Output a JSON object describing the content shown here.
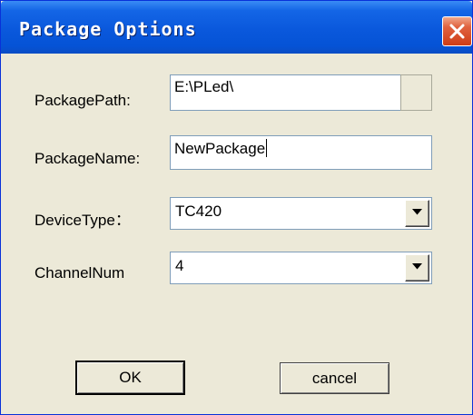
{
  "window": {
    "title": "Package Options",
    "close_icon": "close-icon"
  },
  "form": {
    "package_path": {
      "label": "PackagePath:",
      "value": "E:\\PLed\\"
    },
    "package_name": {
      "label": "PackageName:",
      "value": "NewPackage"
    },
    "device_type": {
      "label": "DeviceType：",
      "value": "TC420"
    },
    "channel_num": {
      "label": "ChannelNum",
      "value": "4"
    }
  },
  "buttons": {
    "ok": "OK",
    "cancel": "cancel"
  },
  "colors": {
    "titlebar": "#0553d6",
    "window_bg": "#ece9d8",
    "close_button": "#cf3d16"
  }
}
